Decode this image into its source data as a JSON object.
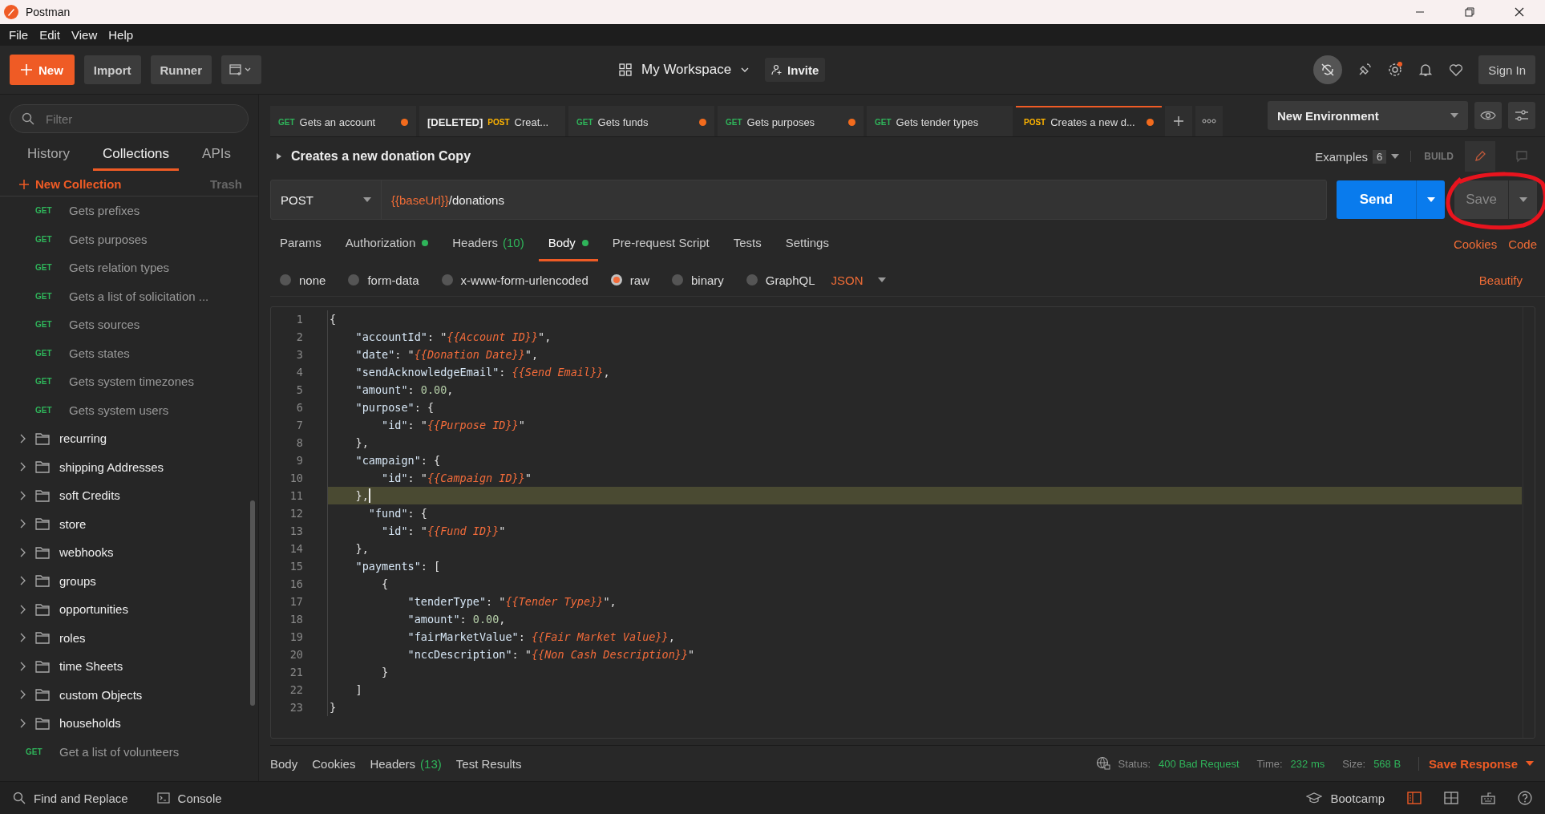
{
  "window": {
    "title": "Postman"
  },
  "menu": [
    "File",
    "Edit",
    "View",
    "Help"
  ],
  "header": {
    "new": "New",
    "import": "Import",
    "runner": "Runner",
    "workspace": "My Workspace",
    "invite": "Invite",
    "sign_in": "Sign In"
  },
  "sidebar": {
    "filter_placeholder": "Filter",
    "tabs": [
      {
        "label": "History",
        "selected": false
      },
      {
        "label": "Collections",
        "selected": true
      },
      {
        "label": "APIs",
        "selected": false
      }
    ],
    "new_collection": "New Collection",
    "trash": "Trash",
    "items": [
      {
        "kind": "request",
        "method": "GET",
        "name": "Gets prefixes"
      },
      {
        "kind": "request",
        "method": "GET",
        "name": "Gets purposes"
      },
      {
        "kind": "request",
        "method": "GET",
        "name": "Gets relation types"
      },
      {
        "kind": "request",
        "method": "GET",
        "name": "Gets a list of solicitation ..."
      },
      {
        "kind": "request",
        "method": "GET",
        "name": "Gets sources"
      },
      {
        "kind": "request",
        "method": "GET",
        "name": "Gets states"
      },
      {
        "kind": "request",
        "method": "GET",
        "name": "Gets system timezones"
      },
      {
        "kind": "request",
        "method": "GET",
        "name": "Gets system users"
      },
      {
        "kind": "folder",
        "name": "recurring"
      },
      {
        "kind": "folder",
        "name": "shipping Addresses"
      },
      {
        "kind": "folder",
        "name": "soft Credits"
      },
      {
        "kind": "folder",
        "name": "store"
      },
      {
        "kind": "folder",
        "name": "webhooks"
      },
      {
        "kind": "folder",
        "name": "groups"
      },
      {
        "kind": "folder",
        "name": "opportunities"
      },
      {
        "kind": "folder",
        "name": "roles"
      },
      {
        "kind": "folder",
        "name": "time Sheets"
      },
      {
        "kind": "folder",
        "name": "custom Objects"
      },
      {
        "kind": "folder",
        "name": "households"
      },
      {
        "kind": "toprequest",
        "method": "GET",
        "name": "Get a list of volunteers"
      }
    ]
  },
  "request_tabs": [
    {
      "method": "GET",
      "name": "Gets an account",
      "unsaved": true,
      "selected": false
    },
    {
      "prefix": "[DELETED]",
      "method": "POST",
      "name": "Creat...",
      "unsaved": false,
      "selected": false
    },
    {
      "method": "GET",
      "name": "Gets funds",
      "unsaved": true,
      "selected": false
    },
    {
      "method": "GET",
      "name": "Gets purposes",
      "unsaved": true,
      "selected": false
    },
    {
      "method": "GET",
      "name": "Gets tender types",
      "unsaved": false,
      "selected": false
    },
    {
      "method": "POST",
      "name": "Creates a new d...",
      "unsaved": true,
      "selected": true
    }
  ],
  "environment": "New Environment",
  "request": {
    "title": "Creates a new donation Copy",
    "examples": "Examples",
    "examples_count": "6",
    "build": "BUILD",
    "method": "POST",
    "url_variable": "{{baseUrl}}",
    "url_path": "/donations",
    "send": "Send",
    "save": "Save"
  },
  "option_tabs": [
    {
      "label": "Params",
      "selected": false,
      "dot": false
    },
    {
      "label": "Authorization",
      "selected": false,
      "dot": true
    },
    {
      "label": "Headers",
      "count": "(10)",
      "selected": false,
      "dot": false
    },
    {
      "label": "Body",
      "selected": true,
      "dot": true
    },
    {
      "label": "Pre-request Script",
      "selected": false,
      "dot": false
    },
    {
      "label": "Tests",
      "selected": false,
      "dot": false
    },
    {
      "label": "Settings",
      "selected": false,
      "dot": false
    }
  ],
  "links": [
    "Cookies",
    "Code"
  ],
  "body_modes": [
    {
      "label": "none",
      "selected": false
    },
    {
      "label": "form-data",
      "selected": false
    },
    {
      "label": "x-www-form-urlencoded",
      "selected": false
    },
    {
      "label": "raw",
      "selected": true
    },
    {
      "label": "binary",
      "selected": false
    },
    {
      "label": "GraphQL",
      "selected": false
    }
  ],
  "format": "JSON",
  "beautify": "Beautify",
  "editor_lines": [
    {
      "number": "1",
      "current": false,
      "tokens": [
        {
          "kind": "punct",
          "text": "{"
        }
      ]
    },
    {
      "number": "2",
      "current": false,
      "tokens": [
        {
          "kind": "key",
          "text": "    \"accountId\""
        },
        {
          "kind": "punct",
          "text": ": \""
        },
        {
          "kind": "var",
          "text": "{{Account ID}}"
        },
        {
          "kind": "punct",
          "text": "\","
        }
      ]
    },
    {
      "number": "3",
      "current": false,
      "tokens": [
        {
          "kind": "key",
          "text": "    \"date\""
        },
        {
          "kind": "punct",
          "text": ": \""
        },
        {
          "kind": "var",
          "text": "{{Donation Date}}"
        },
        {
          "kind": "punct",
          "text": "\","
        }
      ]
    },
    {
      "number": "4",
      "current": false,
      "tokens": [
        {
          "kind": "key",
          "text": "    \"sendAcknowledgeEmail\""
        },
        {
          "kind": "punct",
          "text": ": "
        },
        {
          "kind": "var",
          "text": "{{Send Email}}"
        },
        {
          "kind": "punct",
          "text": ","
        }
      ]
    },
    {
      "number": "5",
      "current": false,
      "tokens": [
        {
          "kind": "key",
          "text": "    \"amount\""
        },
        {
          "kind": "punct",
          "text": ": "
        },
        {
          "kind": "number",
          "text": "0.00"
        },
        {
          "kind": "punct",
          "text": ","
        }
      ]
    },
    {
      "number": "6",
      "current": false,
      "tokens": [
        {
          "kind": "key",
          "text": "    \"purpose\""
        },
        {
          "kind": "punct",
          "text": ": {"
        }
      ]
    },
    {
      "number": "7",
      "current": false,
      "tokens": [
        {
          "kind": "key",
          "text": "        \"id\""
        },
        {
          "kind": "punct",
          "text": ": \""
        },
        {
          "kind": "var",
          "text": "{{Purpose ID}}"
        },
        {
          "kind": "punct",
          "text": "\""
        }
      ]
    },
    {
      "number": "8",
      "current": false,
      "tokens": [
        {
          "kind": "punct",
          "text": "    },"
        }
      ]
    },
    {
      "number": "9",
      "current": false,
      "tokens": [
        {
          "kind": "key",
          "text": "    \"campaign\""
        },
        {
          "kind": "punct",
          "text": ": {"
        }
      ]
    },
    {
      "number": "10",
      "current": false,
      "tokens": [
        {
          "kind": "key",
          "text": "        \"id\""
        },
        {
          "kind": "punct",
          "text": ": \""
        },
        {
          "kind": "var",
          "text": "{{Campaign ID}}"
        },
        {
          "kind": "punct",
          "text": "\""
        }
      ]
    },
    {
      "number": "11",
      "current": true,
      "tokens": [
        {
          "kind": "punct",
          "text": "    },"
        }
      ]
    },
    {
      "number": "12",
      "current": false,
      "tokens": [
        {
          "kind": "key",
          "text": "      \"fund\""
        },
        {
          "kind": "punct",
          "text": ": {"
        }
      ]
    },
    {
      "number": "13",
      "current": false,
      "tokens": [
        {
          "kind": "key",
          "text": "        \"id\""
        },
        {
          "kind": "punct",
          "text": ": \""
        },
        {
          "kind": "var",
          "text": "{{Fund ID}}"
        },
        {
          "kind": "punct",
          "text": "\""
        }
      ]
    },
    {
      "number": "14",
      "current": false,
      "tokens": [
        {
          "kind": "punct",
          "text": "    },"
        }
      ]
    },
    {
      "number": "15",
      "current": false,
      "tokens": [
        {
          "kind": "key",
          "text": "    \"payments\""
        },
        {
          "kind": "punct",
          "text": ": ["
        }
      ]
    },
    {
      "number": "16",
      "current": false,
      "tokens": [
        {
          "kind": "punct",
          "text": "        {"
        }
      ]
    },
    {
      "number": "17",
      "current": false,
      "tokens": [
        {
          "kind": "key",
          "text": "            \"tenderType\""
        },
        {
          "kind": "punct",
          "text": ": \""
        },
        {
          "kind": "var",
          "text": "{{Tender Type}}"
        },
        {
          "kind": "punct",
          "text": "\","
        }
      ]
    },
    {
      "number": "18",
      "current": false,
      "tokens": [
        {
          "kind": "key",
          "text": "            \"amount\""
        },
        {
          "kind": "punct",
          "text": ": "
        },
        {
          "kind": "number",
          "text": "0.00"
        },
        {
          "kind": "punct",
          "text": ","
        }
      ]
    },
    {
      "number": "19",
      "current": false,
      "tokens": [
        {
          "kind": "key",
          "text": "            \"fairMarketValue\""
        },
        {
          "kind": "punct",
          "text": ": "
        },
        {
          "kind": "var",
          "text": "{{Fair Market Value}}"
        },
        {
          "kind": "punct",
          "text": ","
        }
      ]
    },
    {
      "number": "20",
      "current": false,
      "tokens": [
        {
          "kind": "key",
          "text": "            \"nccDescription\""
        },
        {
          "kind": "punct",
          "text": ": \""
        },
        {
          "kind": "var",
          "text": "{{Non Cash Description}}"
        },
        {
          "kind": "punct",
          "text": "\""
        }
      ]
    },
    {
      "number": "21",
      "current": false,
      "tokens": [
        {
          "kind": "punct",
          "text": "        }"
        }
      ]
    },
    {
      "number": "22",
      "current": false,
      "tokens": [
        {
          "kind": "punct",
          "text": "    ]"
        }
      ]
    },
    {
      "number": "23",
      "current": false,
      "tokens": [
        {
          "kind": "punct",
          "text": "}"
        }
      ]
    }
  ],
  "response": {
    "tabs": [
      {
        "label": "Body"
      },
      {
        "label": "Cookies"
      },
      {
        "label": "Headers",
        "count": "(13)"
      },
      {
        "label": "Test Results"
      }
    ],
    "status_label": "Status:",
    "status": "400 Bad Request",
    "time_label": "Time:",
    "time": "232 ms",
    "size_label": "Size:",
    "size": "568 B",
    "save_response": "Save Response"
  },
  "footer": {
    "find_replace": "Find and Replace",
    "console": "Console",
    "bootcamp": "Bootcamp"
  }
}
